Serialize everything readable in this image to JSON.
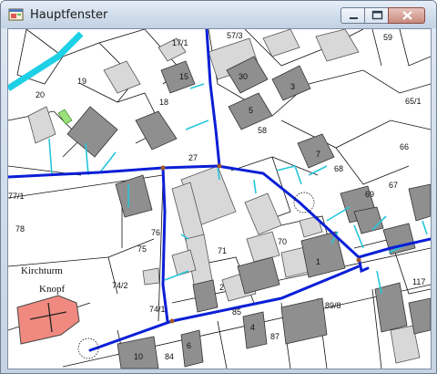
{
  "window": {
    "title": "Hauptfenster"
  },
  "map": {
    "colors": {
      "road": "#0a1fd6",
      "water": "#1ed0e6",
      "building": "#8f8f8f",
      "building_light": "#d8d8d8",
      "church": "#f08a80"
    },
    "parcel_labels": [
      {
        "id": "57_3",
        "text": "57/3"
      },
      {
        "id": "59",
        "text": "59"
      },
      {
        "id": "17_1",
        "text": "17/1"
      },
      {
        "id": "19",
        "text": "19"
      },
      {
        "id": "20",
        "text": "20"
      },
      {
        "id": "18",
        "text": "18"
      },
      {
        "id": "65_1",
        "text": "65/1"
      },
      {
        "id": "58",
        "text": "58"
      },
      {
        "id": "66",
        "text": "66"
      },
      {
        "id": "27",
        "text": "27"
      },
      {
        "id": "68",
        "text": "68"
      },
      {
        "id": "67",
        "text": "67"
      },
      {
        "id": "77_1",
        "text": "77/1"
      },
      {
        "id": "69",
        "text": "69"
      },
      {
        "id": "78",
        "text": "78"
      },
      {
        "id": "76",
        "text": "76"
      },
      {
        "id": "70",
        "text": "70"
      },
      {
        "id": "71",
        "text": "71"
      },
      {
        "id": "75",
        "text": "75"
      },
      {
        "id": "117",
        "text": "117"
      },
      {
        "id": "74_2",
        "text": "74/2"
      },
      {
        "id": "74_1",
        "text": "74/1"
      },
      {
        "id": "85",
        "text": "85"
      },
      {
        "id": "89_8",
        "text": "89/8"
      },
      {
        "id": "87",
        "text": "87"
      },
      {
        "id": "84",
        "text": "84"
      }
    ],
    "building_numbers": [
      {
        "id": "b15",
        "text": "15"
      },
      {
        "id": "b30",
        "text": "30"
      },
      {
        "id": "b3",
        "text": "3"
      },
      {
        "id": "b5",
        "text": "5"
      },
      {
        "id": "b7",
        "text": "7"
      },
      {
        "id": "b1",
        "text": "1"
      },
      {
        "id": "b2",
        "text": "2"
      },
      {
        "id": "b4",
        "text": "4"
      },
      {
        "id": "b6",
        "text": "6"
      },
      {
        "id": "b10",
        "text": "10"
      }
    ],
    "annotations": {
      "kirchturm": "Kirchturm",
      "knopf": "Knopf"
    }
  }
}
